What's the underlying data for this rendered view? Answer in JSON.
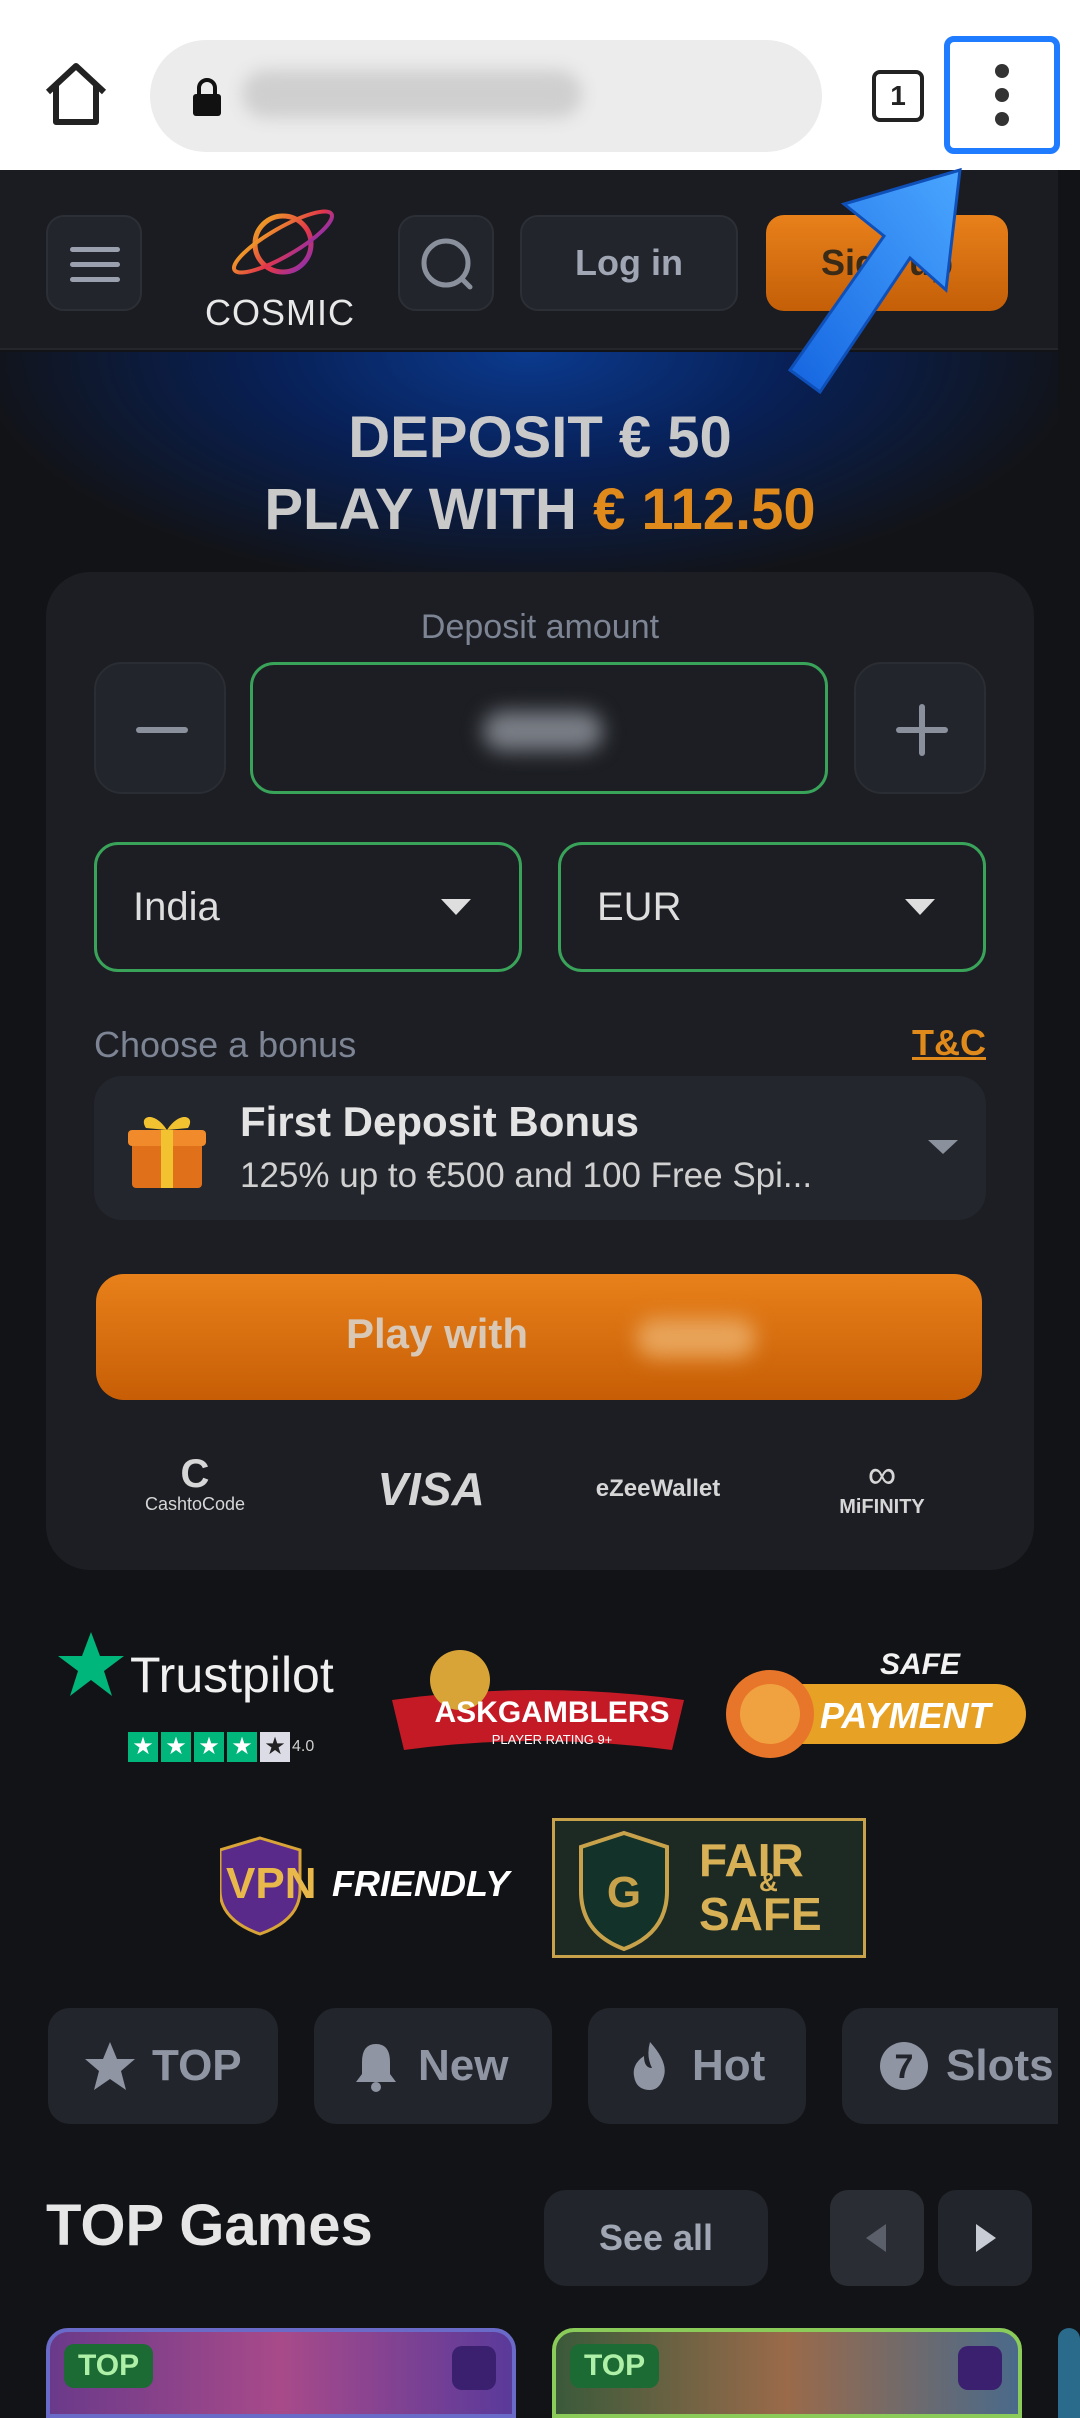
{
  "browser": {
    "tab_count": "1",
    "url_text": ""
  },
  "header": {
    "logo_text": "COSMIC",
    "login_label": "Log in",
    "signup_label": "Sign up"
  },
  "hero": {
    "line1": "DEPOSIT € 50",
    "line2_prefix": "PLAY WITH ",
    "line2_amount": "€ 112.50"
  },
  "deposit": {
    "label": "Deposit amount",
    "country": "India",
    "currency": "EUR",
    "bonus_label": "Choose a bonus",
    "tc_label": "T&C",
    "bonus_title": "First Deposit Bonus",
    "bonus_subtitle": "125% up to €500 and 100 Free Spi...",
    "play_label": "Play with"
  },
  "payments": [
    "CashtoCode",
    "VISA",
    "eZeeWallet",
    "MiFINITY"
  ],
  "badges": {
    "trustpilot_name": "Trustpilot",
    "trustpilot_rating": "4.0",
    "askgamblers_title": "ASKGAMBLERS",
    "askgamblers_sub": "PLAYER RATING 9+",
    "safe_payment_top": "SAFE",
    "safe_payment_bottom": "PAYMENT",
    "vpn_a": "VPN",
    "vpn_b": "FRIENDLY",
    "fair_a": "FAIR",
    "fair_amp": "&",
    "fair_b": "SAFE"
  },
  "categories": [
    {
      "label": "TOP",
      "icon": "star-icon"
    },
    {
      "label": "New",
      "icon": "bell-icon"
    },
    {
      "label": "Hot",
      "icon": "flame-icon"
    },
    {
      "label": "Slots",
      "icon": "seven-icon"
    }
  ],
  "games": {
    "title": "TOP Games",
    "see_all": "See all",
    "cards": [
      {
        "badge": "TOP"
      },
      {
        "badge": "TOP"
      }
    ]
  },
  "colors": {
    "accent_orange": "#e08a1c",
    "field_border_green": "#3aa35a",
    "annotation_blue": "#1f7bff"
  }
}
